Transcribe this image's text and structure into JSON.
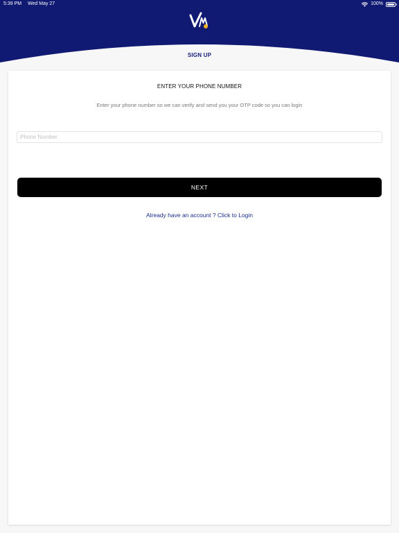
{
  "status_bar": {
    "time": "5:39 PM",
    "date": "Wed May 27",
    "battery_percent": "100%"
  },
  "header": {
    "title": "SIGN UP",
    "background_color": "#111a72"
  },
  "card": {
    "heading": "ENTER YOUR PHONE NUMBER",
    "description": "Enter your phone number so we can verify and send you your OTP code so you can login",
    "phone_input": {
      "placeholder": "Phone Number",
      "value": ""
    },
    "next_label": "NEXT",
    "login_link": "Already have an account ? Click to Login"
  },
  "colors": {
    "brand_navy": "#111a72",
    "button_black": "#000000",
    "link_blue": "#1b2d8a",
    "logo_accent": "#f5b21b"
  },
  "icons": {
    "wifi": "wifi-icon",
    "battery": "battery-icon",
    "logo": "app-logo"
  }
}
